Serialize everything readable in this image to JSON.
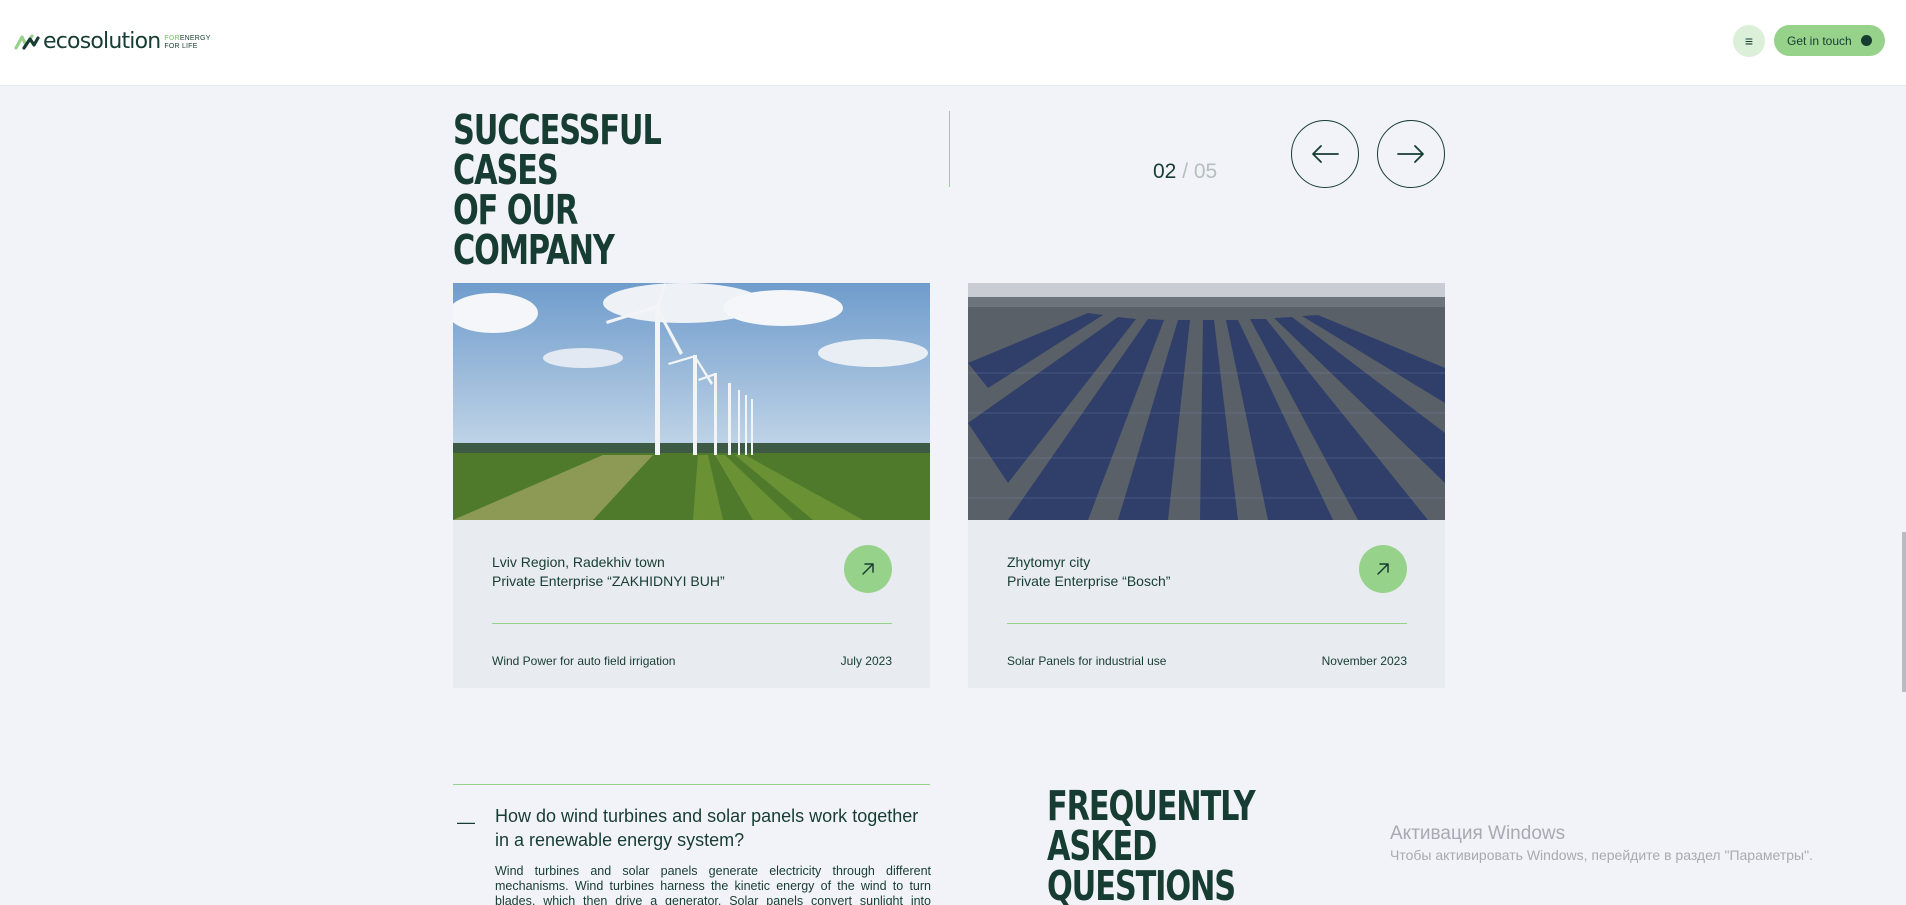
{
  "header": {
    "logo_text": "ecosolution",
    "tagline_line1": "ENERGY",
    "tagline_highlight": "FOR",
    "tagline_line2": "FOR LIFE",
    "menu_icon": "hamburger-menu-icon",
    "cta_label": "Get in touch"
  },
  "cases": {
    "title_line1": "SUCCESSFUL CASES",
    "title_line2": "OF OUR COMPANY",
    "counter_current": "02",
    "counter_sep": " / ",
    "counter_total": "05",
    "prev_icon": "arrow-left-icon",
    "next_icon": "arrow-right-icon",
    "cards": [
      {
        "image": "wind-turbines-field",
        "location": "Lviv Region, Radekhiv town",
        "company": "Private Enterprise “ZAKHIDNYI BUH”",
        "description": "Wind Power for auto field irrigation",
        "date": "July 2023"
      },
      {
        "image": "solar-panel-rows",
        "location": "Zhytomyr city",
        "company": "Private Enterprise “Bosch”",
        "description": "Solar Panels for industrial use",
        "date": "November 2023"
      }
    ]
  },
  "faq": {
    "toggle_symbol": "—",
    "question": "How do wind turbines and solar panels work together in a renewable energy system?",
    "answer": "Wind turbines and solar panels generate electricity through different mechanisms. Wind turbines harness the kinetic energy of the wind to turn blades, which then drive a generator. Solar panels convert sunlight into electricity through",
    "title_line1": "FREQUENTLY ASKED",
    "title_line2": "QUESTIONS"
  },
  "windows_watermark": {
    "title": "Активация Windows",
    "subtitle": "Чтобы активировать Windows, перейдите в раздел \"Параметры\"."
  },
  "colors": {
    "accent": "#97d28b",
    "primary": "#173d33",
    "background": "#f2f3f8",
    "card": "#e8ebf0"
  }
}
